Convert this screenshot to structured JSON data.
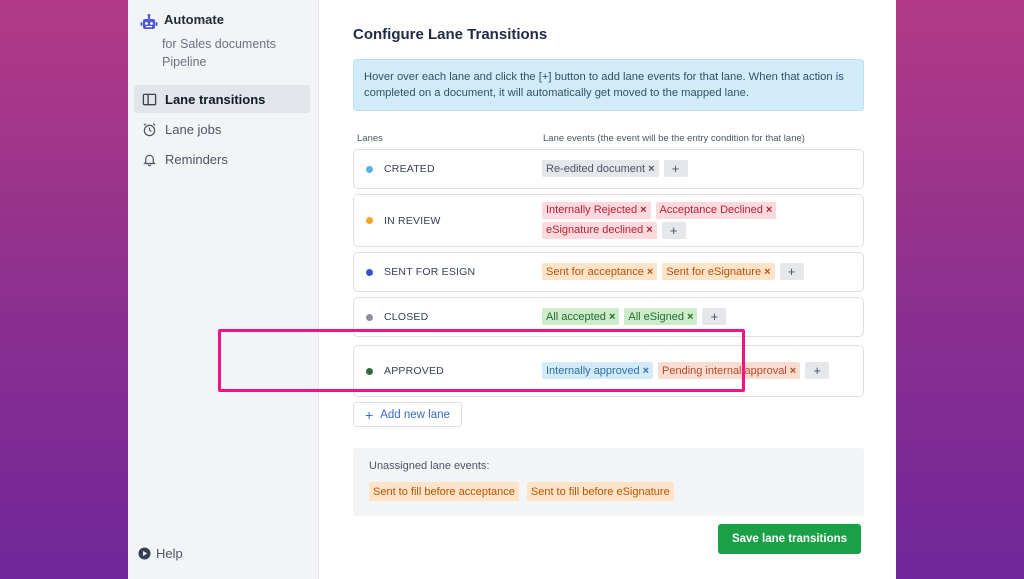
{
  "brand": {
    "title": "Automate",
    "subtitle": "for Sales documents Pipeline",
    "icon": "robot-icon",
    "color": "#4f5bd5"
  },
  "nav": [
    {
      "label": "Lane transitions",
      "icon": "columns-icon",
      "active": true
    },
    {
      "label": "Lane jobs",
      "icon": "alarm-clock-icon",
      "active": false
    },
    {
      "label": "Reminders",
      "icon": "bell-icon",
      "active": false
    }
  ],
  "help": {
    "label": "Help",
    "icon": "play-circle-icon"
  },
  "main": {
    "title": "Configure Lane Transitions",
    "info": "Hover over each lane and click the [+] button to add lane events for that lane. When that action is completed on a document, it will automatically get moved to the mapped lane.",
    "col_lanes": "Lanes",
    "col_events": "Lane events (the event will be the entry condition for that lane)"
  },
  "lanes": [
    {
      "name": "CREATED",
      "dot_color": "#5bb0e6",
      "events": [
        {
          "label": "Re-edited document",
          "style": "gray"
        }
      ]
    },
    {
      "name": "IN REVIEW",
      "dot_color": "#f5a524",
      "events": [
        {
          "label": "Internally Rejected",
          "style": "red"
        },
        {
          "label": "Acceptance Declined",
          "style": "red"
        },
        {
          "label": "eSignature declined",
          "style": "red"
        }
      ]
    },
    {
      "name": "SENT FOR ESIGN",
      "dot_color": "#3d4fcf",
      "events": [
        {
          "label": "Sent for acceptance",
          "style": "orange"
        },
        {
          "label": "Sent for eSignature",
          "style": "orange"
        }
      ]
    },
    {
      "name": "CLOSED",
      "dot_color": "#8a8f98",
      "events": [
        {
          "label": "All accepted",
          "style": "green"
        },
        {
          "label": "All eSigned",
          "style": "green"
        }
      ]
    },
    {
      "name": "APPROVED",
      "dot_color": "#2f6b3f",
      "events": [
        {
          "label": "Internally approved",
          "style": "blue"
        },
        {
          "label": "Pending internal approval",
          "style": "salmon"
        }
      ]
    }
  ],
  "remove_symbol": "×",
  "plus_symbol": "+",
  "add_lane": {
    "label": "Add new lane",
    "symbol": "+"
  },
  "unassigned": {
    "label": "Unassigned lane events:",
    "events": [
      "Sent to fill before acceptance",
      "Sent to fill before eSignature"
    ]
  },
  "save_label": "Save lane transitions",
  "colors": {
    "highlight": "#ef1481",
    "save": "#1aa147"
  }
}
